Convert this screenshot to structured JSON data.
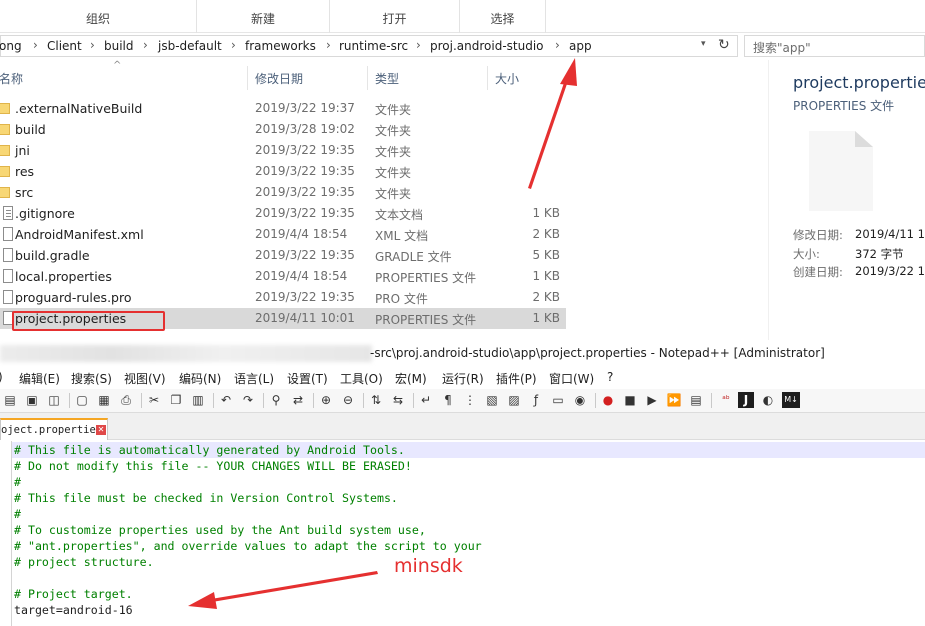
{
  "explorer": {
    "ribbon": [
      {
        "label": "组织"
      },
      {
        "label": "新建"
      },
      {
        "label": "打开"
      },
      {
        "label": "选择"
      }
    ],
    "breadcrumbs": [
      "ong",
      "Client",
      "build",
      "jsb-default",
      "frameworks",
      "runtime-src",
      "proj.android-studio",
      "app"
    ],
    "search_placeholder": "搜索\"app\"",
    "columns": {
      "name": "名称",
      "date": "修改日期",
      "type": "类型",
      "size": "大小"
    },
    "files": [
      {
        "name": ".externalNativeBuild",
        "date": "2019/3/22 19:37",
        "type": "文件夹",
        "size": "",
        "kind": "folder"
      },
      {
        "name": "build",
        "date": "2019/3/28 19:02",
        "type": "文件夹",
        "size": "",
        "kind": "folder"
      },
      {
        "name": "jni",
        "date": "2019/3/22 19:35",
        "type": "文件夹",
        "size": "",
        "kind": "folder"
      },
      {
        "name": "res",
        "date": "2019/3/22 19:35",
        "type": "文件夹",
        "size": "",
        "kind": "folder"
      },
      {
        "name": "src",
        "date": "2019/3/22 19:35",
        "type": "文件夹",
        "size": "",
        "kind": "folder"
      },
      {
        "name": ".gitignore",
        "date": "2019/3/22 19:35",
        "type": "文本文档",
        "size": "1 KB",
        "kind": "text-file"
      },
      {
        "name": "AndroidManifest.xml",
        "date": "2019/4/4 18:54",
        "type": "XML 文档",
        "size": "2 KB",
        "kind": "file"
      },
      {
        "name": "build.gradle",
        "date": "2019/3/22 19:35",
        "type": "GRADLE 文件",
        "size": "5 KB",
        "kind": "file"
      },
      {
        "name": "local.properties",
        "date": "2019/4/4 18:54",
        "type": "PROPERTIES 文件",
        "size": "1 KB",
        "kind": "file"
      },
      {
        "name": "proguard-rules.pro",
        "date": "2019/3/22 19:35",
        "type": "PRO 文件",
        "size": "2 KB",
        "kind": "file"
      },
      {
        "name": "project.properties",
        "date": "2019/4/11 10:01",
        "type": "PROPERTIES 文件",
        "size": "1 KB",
        "kind": "file",
        "selected": true
      }
    ],
    "preview": {
      "name": "project.properties",
      "type": "PROPERTIES 文件",
      "modified_label": "修改日期:",
      "modified_value": "2019/4/11 1",
      "size_label": "大小:",
      "size_value": "372 字节",
      "created_label": "创建日期:",
      "created_value": "2019/3/22 1"
    }
  },
  "notepad": {
    "title": "-src\\proj.android-studio\\app\\project.properties - Notepad++ [Administrator]",
    "menu": [
      ")",
      "编辑(E)",
      "搜索(S)",
      "视图(V)",
      "编码(N)",
      "语言(L)",
      "设置(T)",
      "工具(O)",
      "宏(M)",
      "运行(R)",
      "插件(P)",
      "窗口(W)",
      "?"
    ],
    "toolbar_icons": [
      "open-icon",
      "save-icon",
      "save-all-icon",
      "close-icon",
      "close-all-icon",
      "print-icon",
      "cut-icon",
      "copy-icon",
      "paste-icon",
      "undo-icon",
      "redo-icon",
      "find-icon",
      "replace-icon",
      "zoom-in-icon",
      "zoom-out-icon",
      "sync-vertical-icon",
      "sync-horizontal-icon",
      "word-wrap-icon",
      "show-all-chars-icon",
      "indent-guide-icon",
      "udl-icon",
      "doc-map-icon",
      "function-list-icon",
      "folder-workspace-icon",
      "monitor-icon",
      "record-macro-icon",
      "stop-macro-icon",
      "play-macro-icon",
      "run-macro-multiple-icon",
      "save-macro-icon",
      "spell-check-icon",
      "j-icon",
      "plugin-icon",
      "markdown-icon"
    ],
    "tab_label": "oject.properties",
    "code_lines": [
      {
        "text": "# This file is automatically generated by Android Tools.",
        "kind": "comment"
      },
      {
        "text": "# Do not modify this file -- YOUR CHANGES WILL BE ERASED!",
        "kind": "comment"
      },
      {
        "text": "#",
        "kind": "comment"
      },
      {
        "text": "# This file must be checked in Version Control Systems.",
        "kind": "comment"
      },
      {
        "text": "#",
        "kind": "comment"
      },
      {
        "text": "# To customize properties used by the Ant build system use,",
        "kind": "comment"
      },
      {
        "text": "# \"ant.properties\", and override values to adapt the script to your",
        "kind": "comment"
      },
      {
        "text": "# project structure.",
        "kind": "comment"
      },
      {
        "text": "",
        "kind": "plain"
      },
      {
        "text": "# Project target.",
        "kind": "comment"
      },
      {
        "text": "target=android-16",
        "kind": "plain"
      }
    ]
  },
  "annotation": {
    "label": "minsdk",
    "color": "#e53030"
  }
}
